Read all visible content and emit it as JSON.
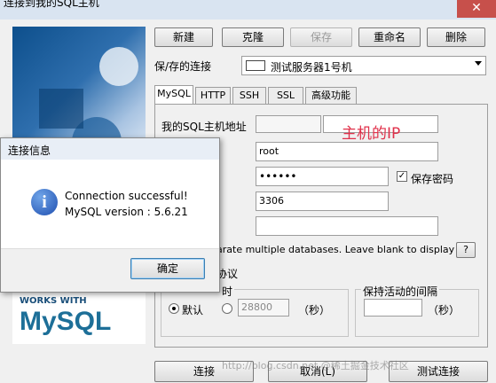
{
  "window": {
    "title": "连接到我的SQL主机",
    "close_symbol": "✕"
  },
  "toolbar": {
    "new": "新建",
    "clone": "克隆",
    "save": "保存",
    "rename": "重命名",
    "delete": "删除"
  },
  "saved_conn": {
    "label": "保/存的连接",
    "value": "测试服务器1号机"
  },
  "tabs": [
    "MySQL",
    "HTTP",
    "SSH",
    "SSL",
    "高级功能"
  ],
  "form": {
    "host_label": "我的SQL主机地址",
    "host_annotation": "主机的IP",
    "user_value": "root",
    "password_value": "••••••",
    "save_password_label": "保存密码",
    "port_value": "3306",
    "db_hint": "arate multiple databases. Leave blank to display all)",
    "help": "?",
    "protocol_label": "协议",
    "timeout_label": "时",
    "default_label": "默认",
    "timeout_value": "28800",
    "seconds_1": "（秒）",
    "keepalive_label": "保持活动的间隔",
    "seconds_2": "（秒）"
  },
  "logo": {
    "works_with": "WORKS WITH",
    "mysql": "MySQL"
  },
  "bottom": {
    "connect": "连接",
    "cancel": "取消(L)",
    "test": "测试连接",
    "watermark": "http://blog.csdn.net @稀土掘金技术社区"
  },
  "dialog": {
    "title": "连接信息",
    "line1": "Connection successful!",
    "line2": "MySQL version : 5.6.21",
    "ok": "确定",
    "info_symbol": "i"
  }
}
